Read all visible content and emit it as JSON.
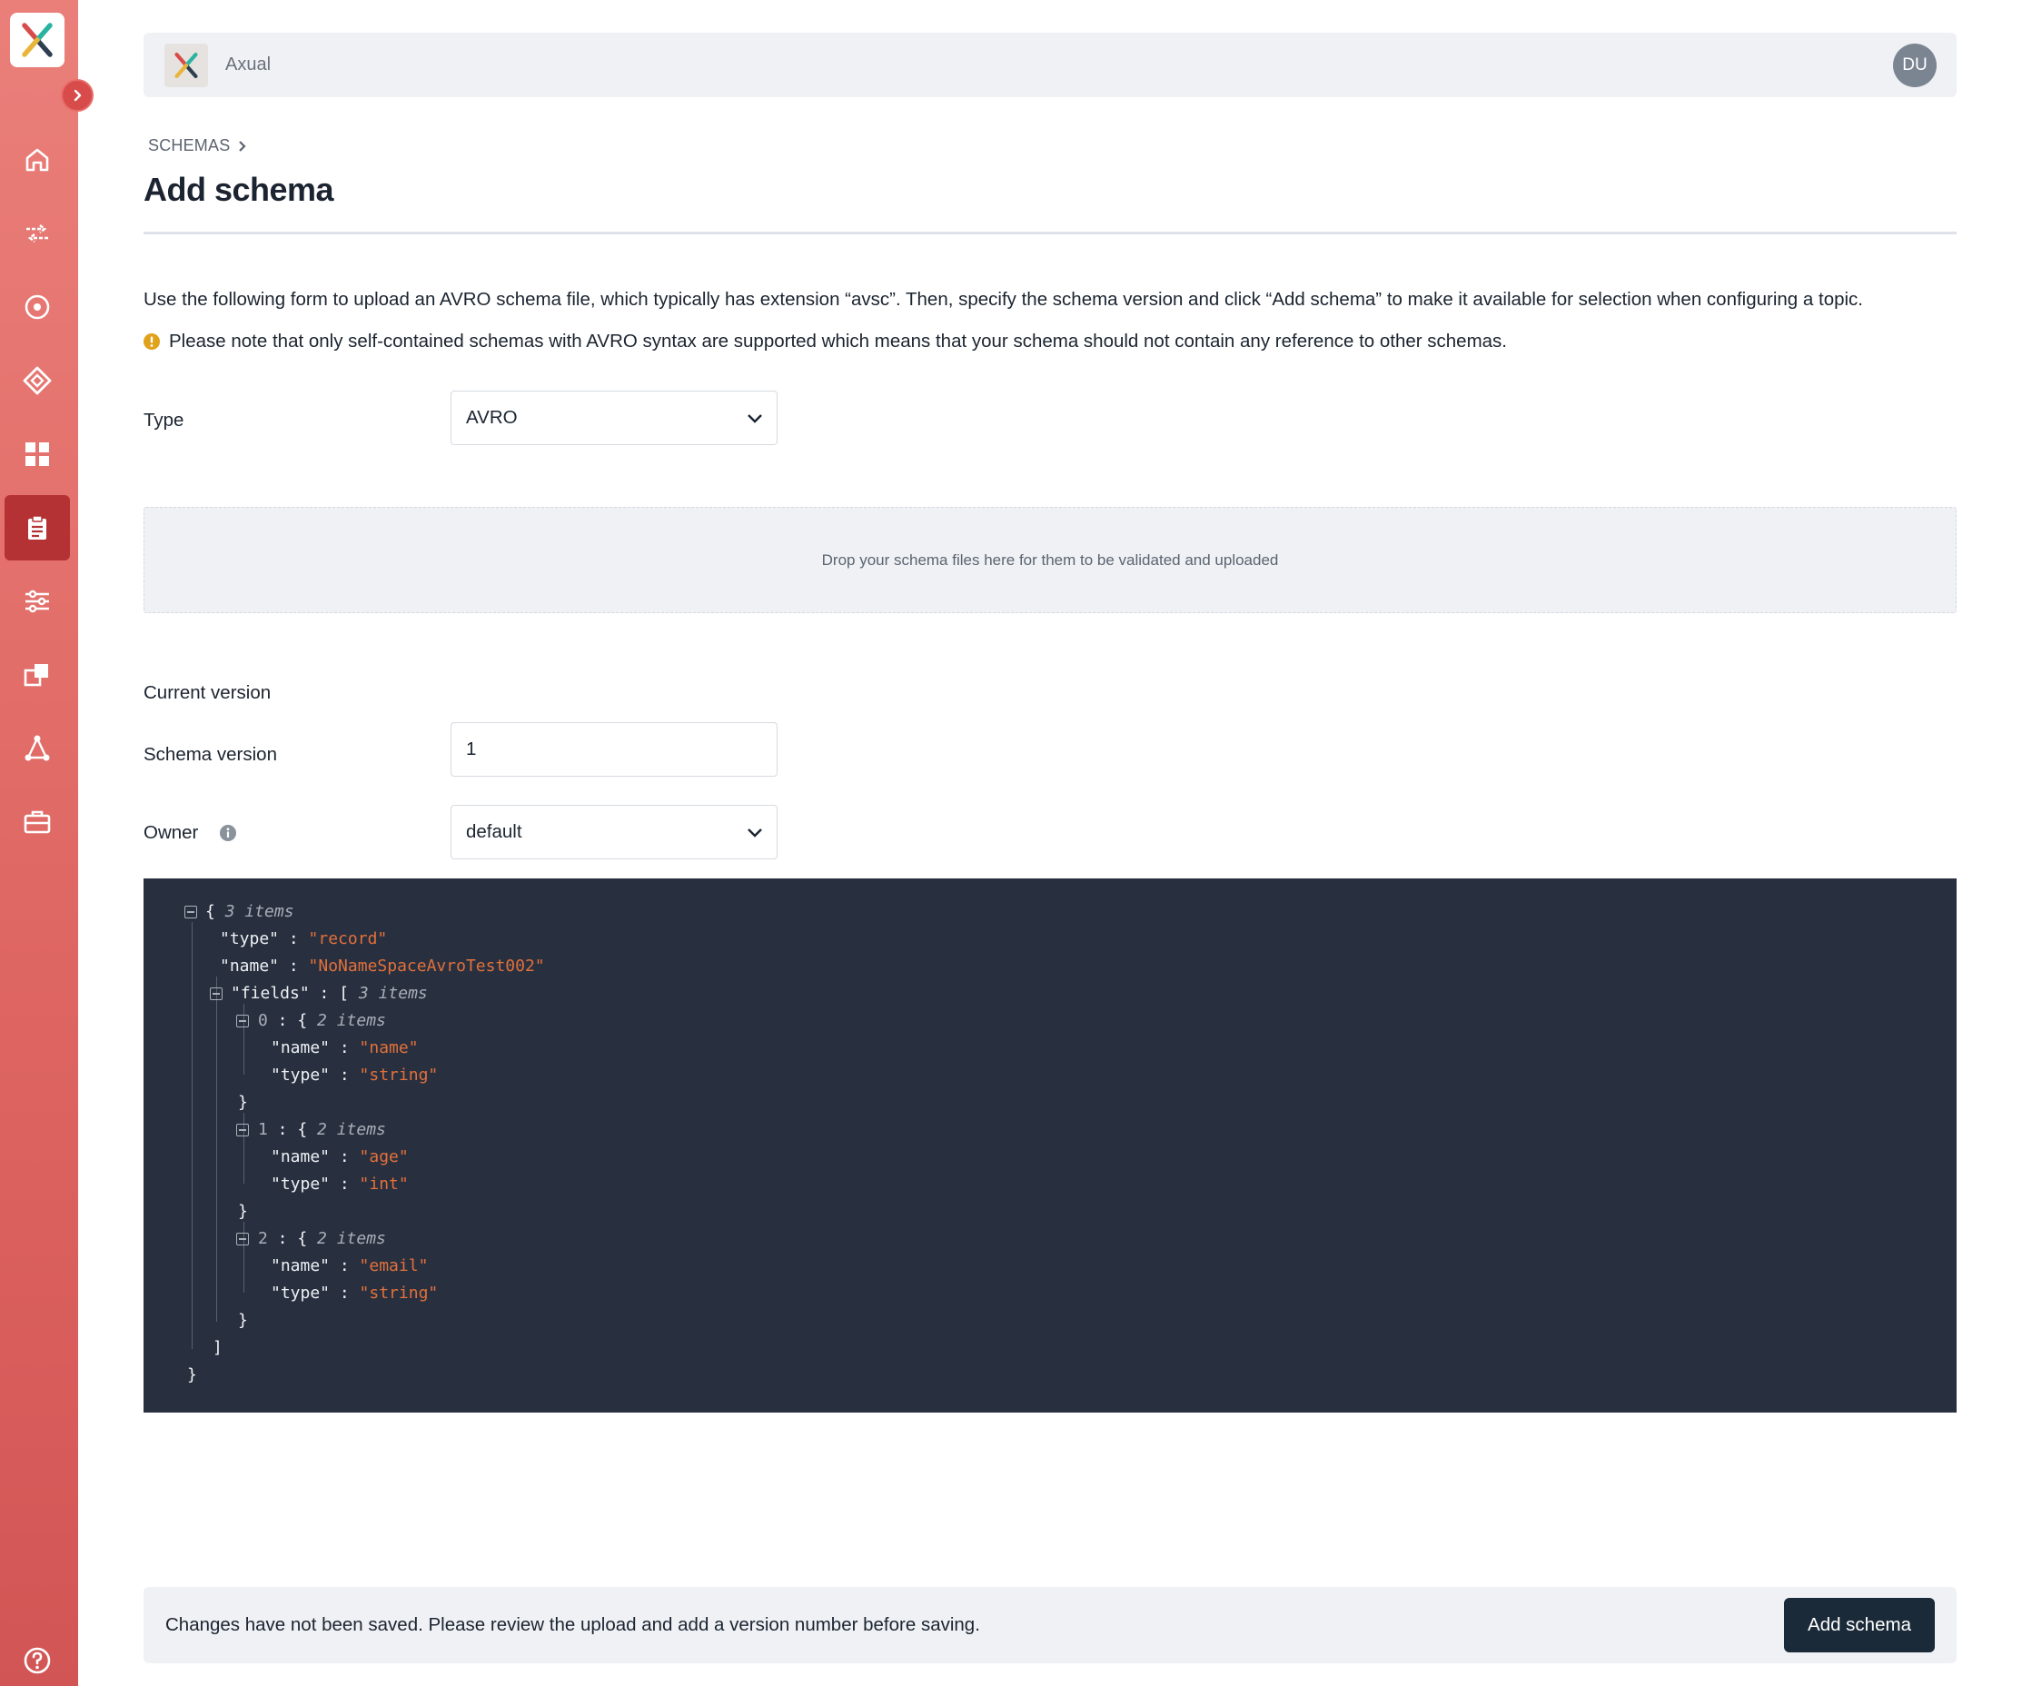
{
  "app": {
    "name": "Axual",
    "user_initials": "DU"
  },
  "sidebar": {
    "items": [
      {
        "icon": "home-icon"
      },
      {
        "icon": "streams-icon"
      },
      {
        "icon": "target-icon"
      },
      {
        "icon": "diamond-icon"
      },
      {
        "icon": "dashboard-icon"
      },
      {
        "icon": "clipboard-icon",
        "active": true
      },
      {
        "icon": "sliders-icon"
      },
      {
        "icon": "copy-icon"
      },
      {
        "icon": "network-icon"
      },
      {
        "icon": "toolbox-icon"
      }
    ],
    "help_icon": "help-icon"
  },
  "breadcrumb": {
    "label": "SCHEMAS"
  },
  "page": {
    "title": "Add schema",
    "description": "Use the following form to upload an AVRO schema file, which typically has extension “avsc”. Then, specify the schema version and click “Add schema” to make it available for selection when configuring a topic.",
    "note": "Please note that only self-contained schemas with AVRO syntax are supported which means that your schema should not contain any reference to other schemas."
  },
  "form": {
    "type_label": "Type",
    "type_value": "AVRO",
    "dropzone_text": "Drop your schema files here for them to be validated and uploaded",
    "current_version_label": "Current version",
    "schema_version_label": "Schema version",
    "schema_version_value": "1",
    "owner_label": "Owner",
    "owner_value": "default"
  },
  "json": {
    "root_count": "3 items",
    "type_key": "\"type\"",
    "type_val": "\"record\"",
    "name_key": "\"name\"",
    "name_val": "\"NoNameSpaceAvroTest002\"",
    "fields_key": "\"fields\"",
    "fields_count": "3 items",
    "fields": [
      {
        "index": "0",
        "count": "2 items",
        "name_val": "\"name\"",
        "type_val": "\"string\""
      },
      {
        "index": "1",
        "count": "2 items",
        "name_val": "\"age\"",
        "type_val": "\"int\""
      },
      {
        "index": "2",
        "count": "2 items",
        "name_val": "\"email\"",
        "type_val": "\"string\""
      }
    ]
  },
  "footer": {
    "message": "Changes have not been saved. Please review the upload and add a version number before saving.",
    "button_label": "Add schema"
  },
  "colors": {
    "sidebar": "#df6763",
    "active_nav": "#b53234",
    "button": "#1b2a38",
    "json_bg": "#283040",
    "json_string": "#e2703a",
    "warning": "#e0a21b"
  }
}
